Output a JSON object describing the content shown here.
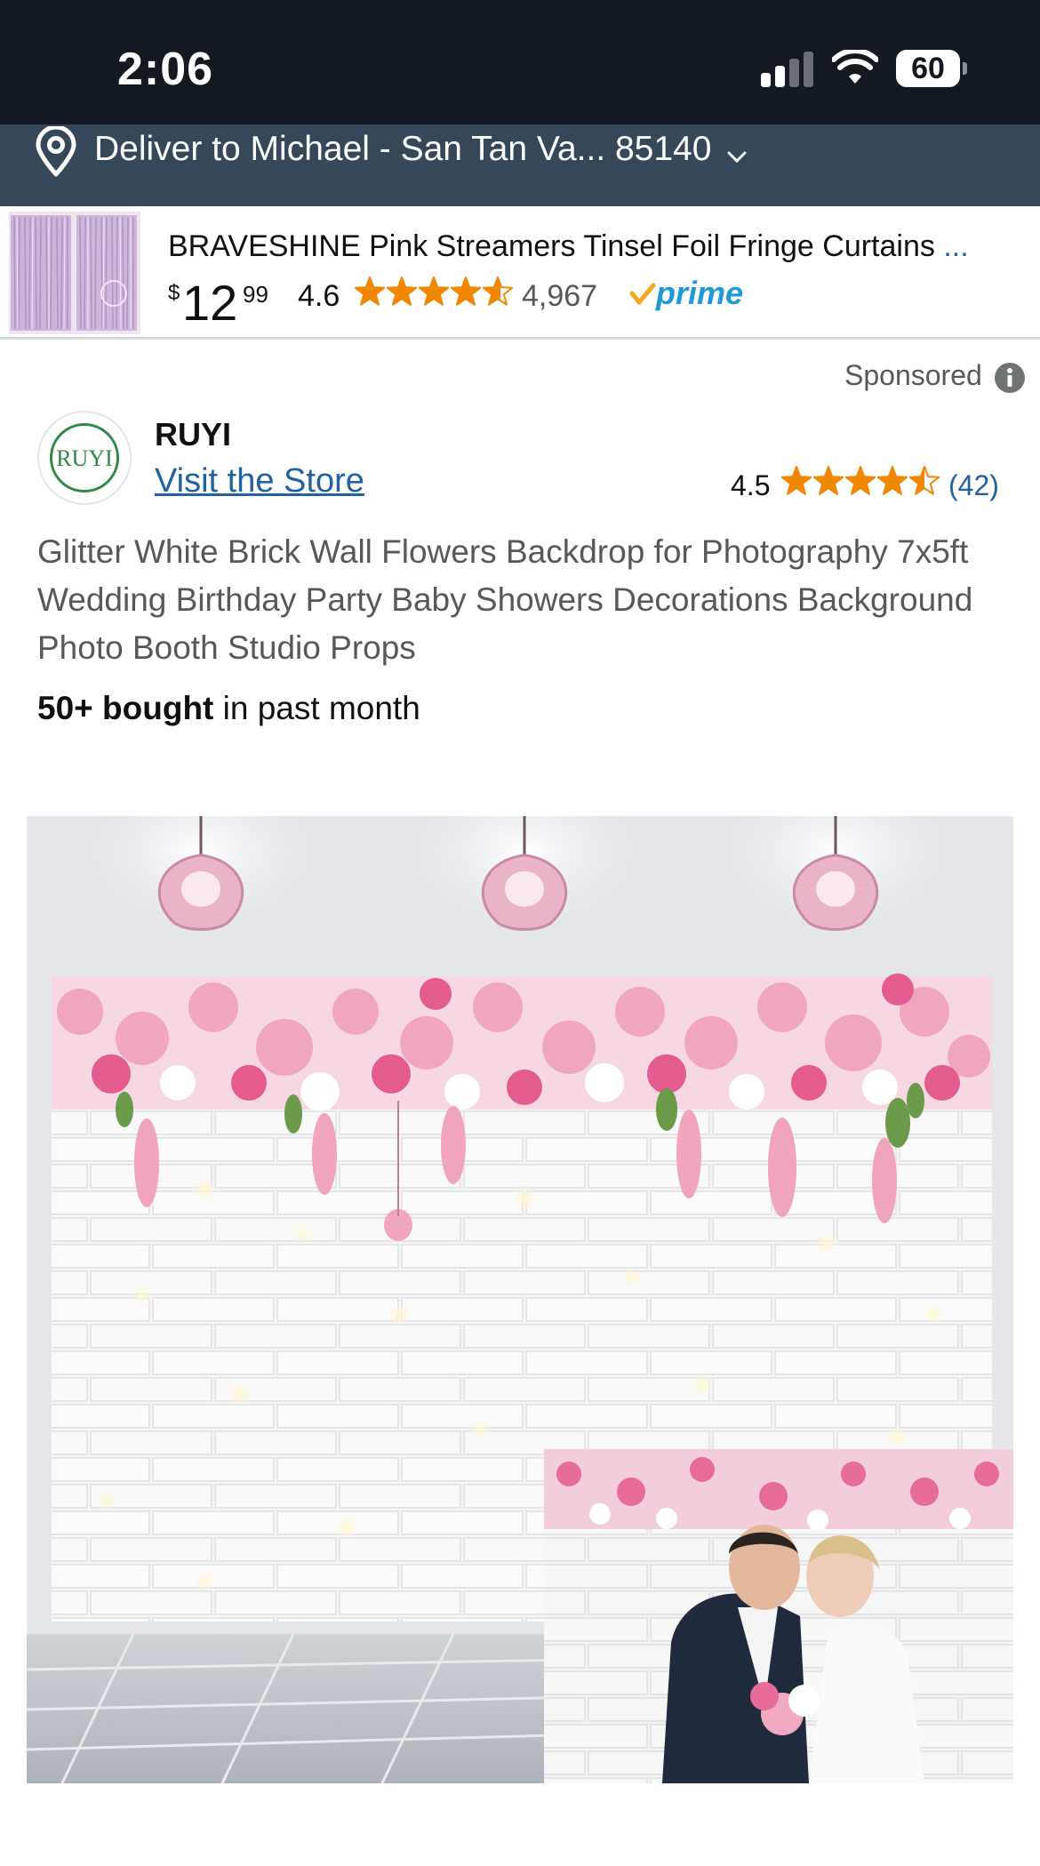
{
  "status_bar": {
    "time": "2:06",
    "battery": "60",
    "signal_icon": "cellular-signal-icon",
    "wifi_icon": "wifi-icon",
    "colors": {
      "background": "#131921"
    }
  },
  "deliver": {
    "text": "Deliver to Michael - San Tan Va... 85140",
    "pin_icon": "location-pin-icon",
    "chevron_icon": "chevron-down-icon",
    "colors": {
      "background": "#37475a"
    }
  },
  "banner": {
    "title": "BRAVESHINE Pink Streamers Tinsel Foil Fringe Curtains",
    "more": "...",
    "price": {
      "currency": "$",
      "whole": "12",
      "fraction": "99"
    },
    "rating": "4.6",
    "rating_value": 4.6,
    "review_count": "4,967",
    "prime": "prime",
    "thumbnail": "pink-tinsel-curtain-thumbnail"
  },
  "listing": {
    "sponsored": "Sponsored",
    "info_icon": "info-icon",
    "store": {
      "logo_text": "RUYI",
      "name": "RUYI",
      "visit_label": "Visit the Store"
    },
    "rating": "4.5",
    "rating_value": 4.5,
    "review_count": "(42)",
    "title": "Glitter White Brick Wall Flowers Backdrop for Photography 7x5ft Wedding Birthday Party Baby Showers Decorations Background Photo Booth Studio Props",
    "bought_bold": "50+ bought",
    "bought_rest": " in past month",
    "image": "white-brick-wall-floral-backdrop-photo",
    "colors": {
      "star": "#f08804",
      "link": "#2162a1",
      "prime": "#1e9ad6"
    }
  }
}
